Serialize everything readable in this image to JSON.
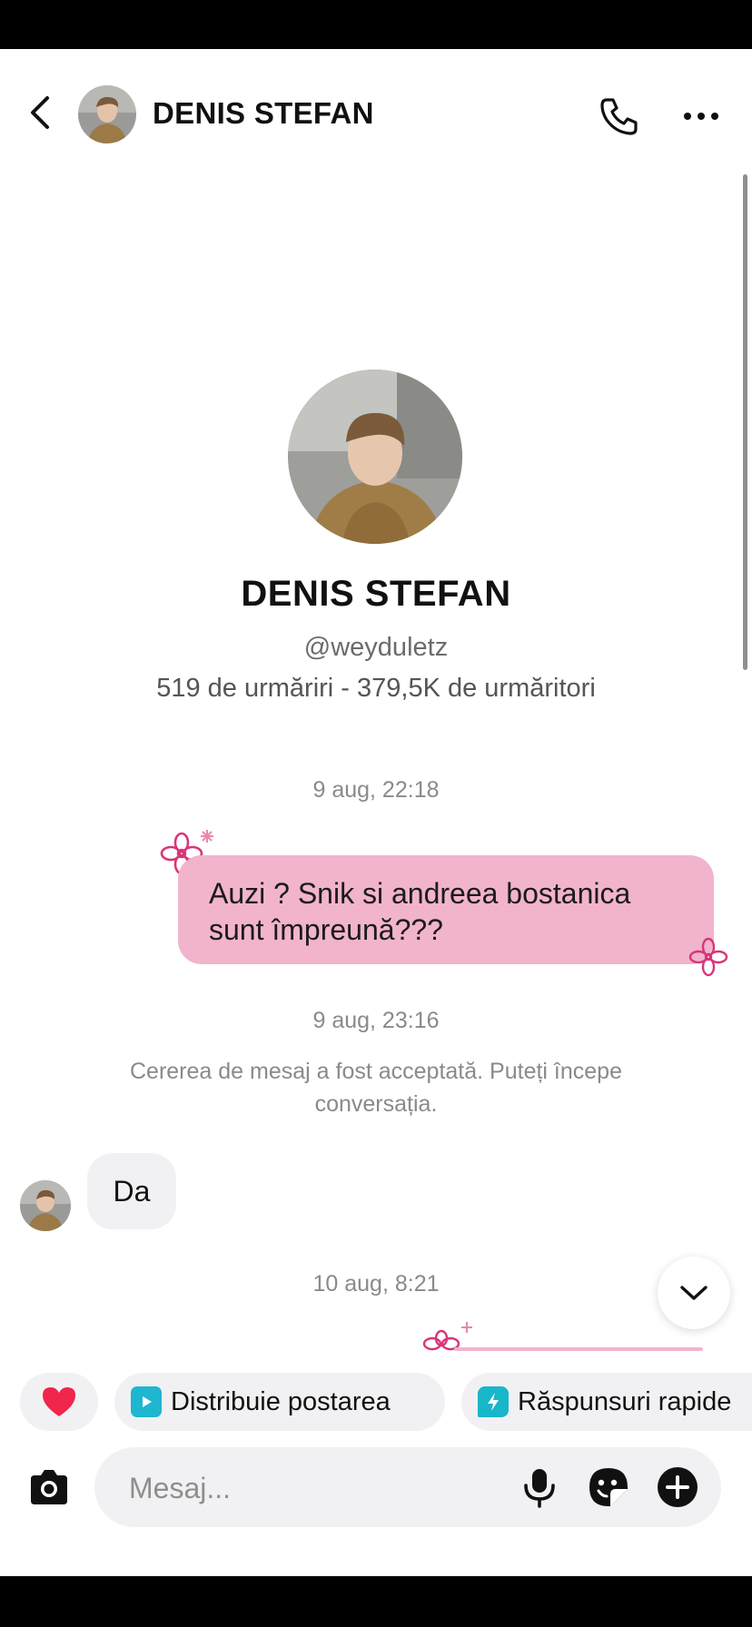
{
  "header": {
    "contact_name": "DENIS STEFAN"
  },
  "profile": {
    "name": "DENIS STEFAN",
    "handle": "@weyduletz",
    "stats": "519 de urmăriri - 379,5K de urmăritori"
  },
  "messages": {
    "timestamp_1": "9 aug, 22:18",
    "outgoing_1": "Auzi ? Snik si andreea bostanica sunt împreună???",
    "timestamp_2": "9 aug, 23:16",
    "system_note": "Cererea de mesaj a fost acceptată. Puteți începe conversația.",
    "incoming_1": "Da",
    "timestamp_3": "10 aug, 8:21"
  },
  "quick_actions": {
    "share_post": "Distribuie postarea",
    "quick_replies": "Răspunsuri rapide"
  },
  "composer": {
    "placeholder": "Mesaj..."
  },
  "colors": {
    "bubble_out": "#f2b3cd",
    "heart": "#f0264c",
    "share_icon": "#1fb6d0",
    "quick_icon": "#18b6c9",
    "flower": "#d8357a"
  },
  "icons": {
    "back": "chevron-left-icon",
    "call": "phone-icon",
    "more": "more-horizontal-icon",
    "scroll_down": "chevron-down-icon",
    "like": "heart-icon",
    "share": "play-square-icon",
    "quick": "bolt-bubble-icon",
    "camera": "camera-icon",
    "mic": "microphone-icon",
    "sticker": "sticker-icon",
    "plus": "plus-circle-icon"
  }
}
